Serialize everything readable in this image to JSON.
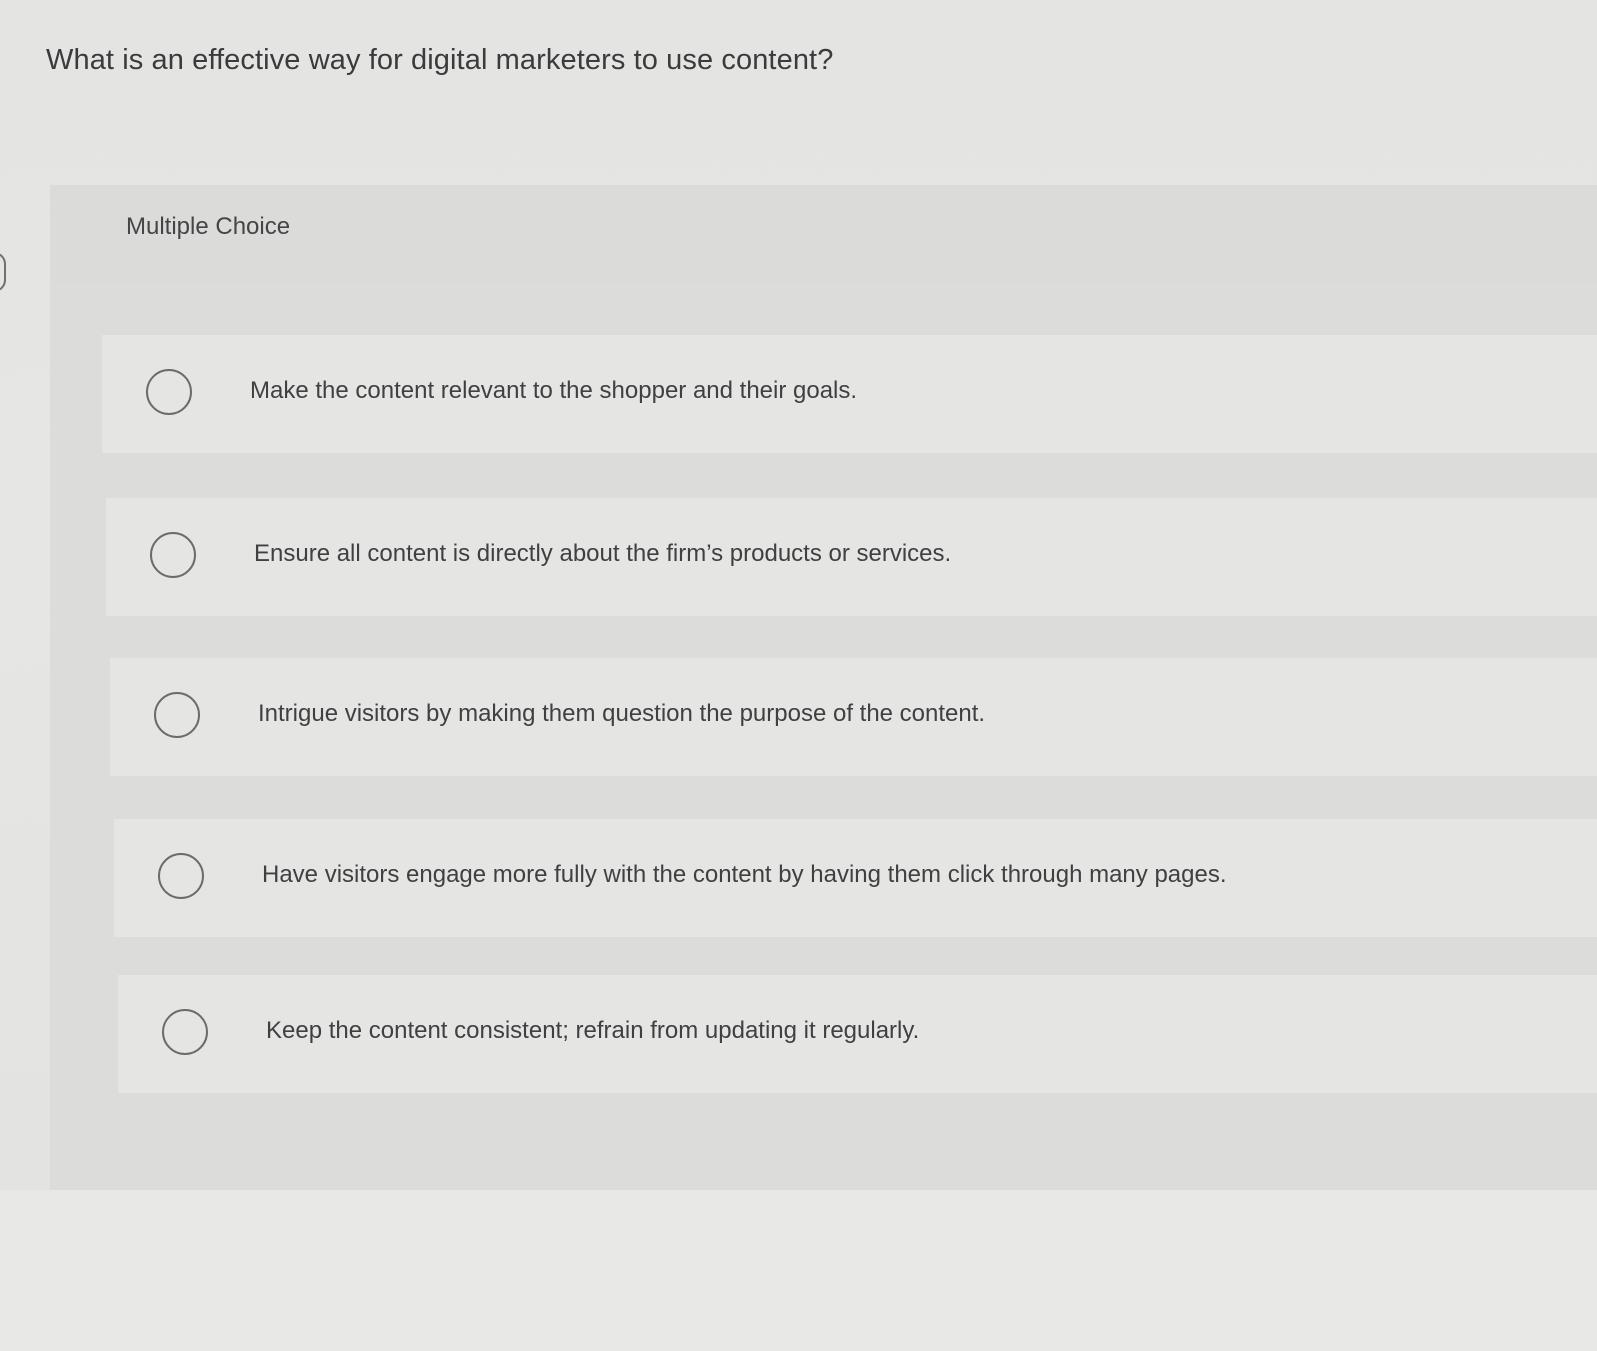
{
  "question": {
    "text": "What is an effective way for digital marketers to use content?"
  },
  "panel": {
    "type_label": "Multiple Choice"
  },
  "options": [
    {
      "label": "Make the content relevant to the shopper and their goals.",
      "selected": false
    },
    {
      "label": "Ensure all content is directly about the firm’s products or services.",
      "selected": false
    },
    {
      "label": "Intrigue visitors by making them question the purpose of the content.",
      "selected": false
    },
    {
      "label": "Have visitors engage more fully with the content by having them click through many pages.",
      "selected": false
    },
    {
      "label": "Keep the content consistent; refrain from updating it regularly.",
      "selected": false
    }
  ],
  "colors": {
    "background": "#e4e4e2",
    "panel": "#dcdcda",
    "option_row": "#e5e5e3",
    "text": "#3b3b3e",
    "radio_border": "#6b6b6e"
  }
}
